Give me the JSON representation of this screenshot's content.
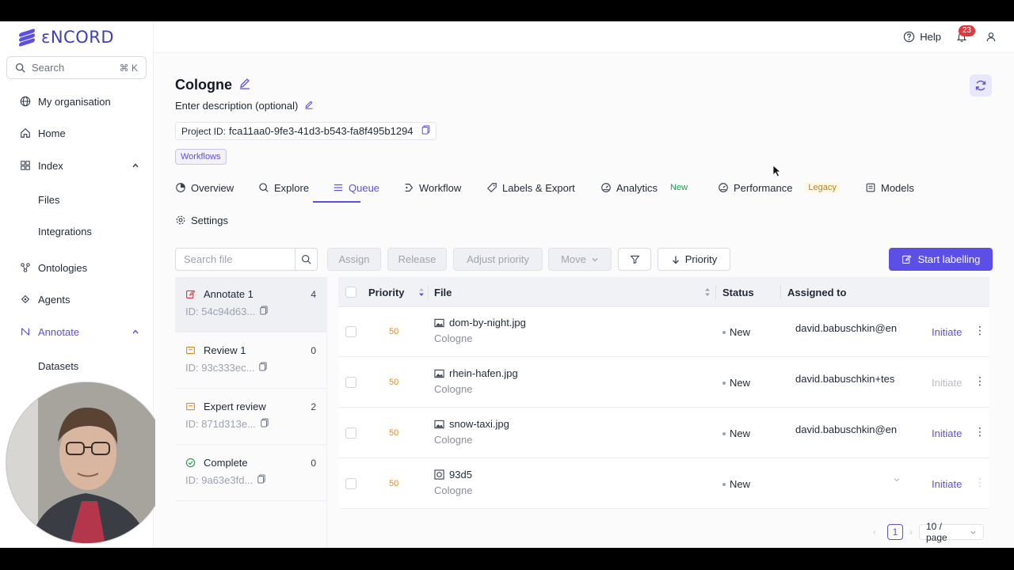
{
  "brand": {
    "name": "ENCORD",
    "accent": "#5b4fe5"
  },
  "sidebar": {
    "search": {
      "placeholder": "Search",
      "shortcut": "⌘ K"
    },
    "items": [
      {
        "label": "My organisation",
        "icon": "globe-icon"
      },
      {
        "label": "Home",
        "icon": "home-icon"
      },
      {
        "label": "Index",
        "icon": "grid-icon",
        "expanded": true
      },
      {
        "label": "Files"
      },
      {
        "label": "Integrations"
      },
      {
        "label": "Ontologies",
        "icon": "ontology-icon"
      },
      {
        "label": "Agents",
        "icon": "agents-icon"
      },
      {
        "label": "Annotate",
        "icon": "annotate-icon",
        "expanded": true,
        "active": true
      },
      {
        "label": "Datasets"
      }
    ]
  },
  "topbar": {
    "help_label": "Help",
    "notification_count": "23"
  },
  "project": {
    "title": "Cologne",
    "description": "Enter description (optional)",
    "id_label": "Project ID:",
    "id_value": "fca11aa0-9fe3-41d3-b543-fa8f495b1294",
    "tag": "Workflows"
  },
  "tabs": [
    {
      "label": "Overview",
      "icon": "overview-icon"
    },
    {
      "label": "Explore",
      "icon": "search-icon"
    },
    {
      "label": "Queue",
      "icon": "list-icon",
      "active": true
    },
    {
      "label": "Workflow",
      "icon": "workflow-icon"
    },
    {
      "label": "Labels & Export",
      "icon": "tag-icon"
    },
    {
      "label": "Analytics",
      "icon": "gauge-icon",
      "pill": "New"
    },
    {
      "label": "Performance",
      "icon": "gauge-icon",
      "pill": "Legacy"
    },
    {
      "label": "Models",
      "icon": "models-icon"
    },
    {
      "label": "Settings",
      "icon": "gear-icon"
    }
  ],
  "toolbar": {
    "search_placeholder": "Search file",
    "assign": "Assign",
    "release": "Release",
    "adjust_priority": "Adjust priority",
    "move": "Move",
    "sort": "Priority",
    "start": "Start labelling"
  },
  "stages": [
    {
      "name": "Annotate 1",
      "id": "ID: 54c94d63...",
      "count": "4",
      "icon": "edit-icon",
      "active": true
    },
    {
      "name": "Review 1",
      "id": "ID: 93c333ec...",
      "count": "0",
      "icon": "review-icon"
    },
    {
      "name": "Expert review",
      "id": "ID: 871d313e...",
      "count": "2",
      "icon": "review-icon"
    },
    {
      "name": "Complete",
      "id": "ID: 9a63e3fd...",
      "count": "0",
      "icon": "check-circle-icon"
    }
  ],
  "table": {
    "headers": {
      "priority": "Priority",
      "file": "File",
      "status": "Status",
      "assigned": "Assigned to"
    },
    "rows": [
      {
        "priority": "50",
        "file": "dom-by-night.jpg",
        "dataset": "Cologne",
        "status": "New",
        "assigned": "david.babuschkin@en",
        "action": "Initiate",
        "action_enabled": true
      },
      {
        "priority": "50",
        "file": "rhein-hafen.jpg",
        "dataset": "Cologne",
        "status": "New",
        "assigned": "david.babuschkin+tes",
        "action": "Initiate",
        "action_enabled": false
      },
      {
        "priority": "50",
        "file": "snow-taxi.jpg",
        "dataset": "Cologne",
        "status": "New",
        "assigned": "david.babuschkin@en",
        "action": "Initiate",
        "action_enabled": true
      },
      {
        "priority": "50",
        "file": "93d5",
        "dataset": "Cologne",
        "status": "New",
        "assigned": "",
        "action": "Initiate",
        "action_enabled": true
      }
    ]
  },
  "pagination": {
    "current": "1",
    "page_size": "10 / page"
  }
}
